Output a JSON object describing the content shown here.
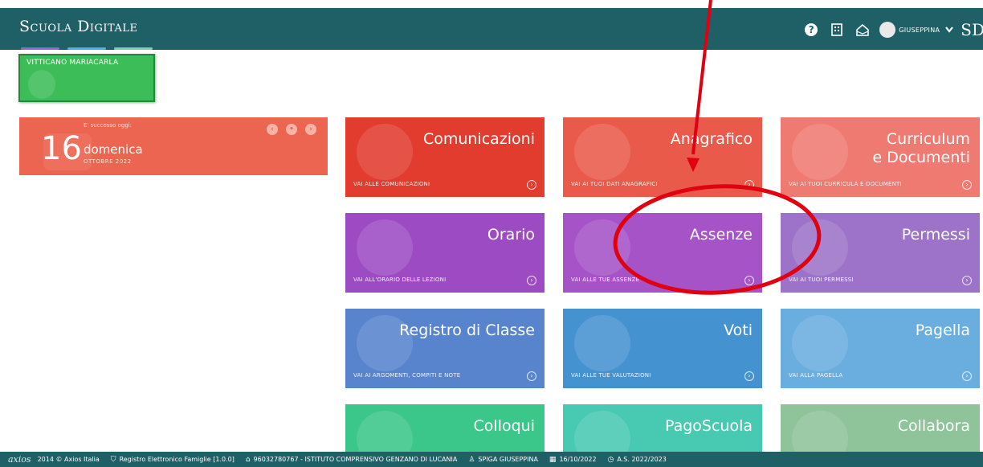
{
  "header": {
    "brand": "Scuola Digitale",
    "user_name": "GIUSEPPINA",
    "logo_short": "SD",
    "colors": {
      "bar": "#1f5f66",
      "line1": "#8e6bd1",
      "line2": "#55aee2",
      "line3": "#7fd0a2"
    }
  },
  "student": {
    "name": "VITTICANO MARIACARLA"
  },
  "calendar": {
    "subtitle": "E' successo oggi:",
    "day": "16",
    "weekday": "domenica",
    "month": "OTTOBRE 2022"
  },
  "tiles": [
    {
      "title": "Comunicazioni",
      "link": "VAI ALLE COMUNICAZIONI",
      "color": "#e23c2f",
      "icon": "megaphone-icon"
    },
    {
      "title": "Anagrafico",
      "link": "VAI AI TUOI DATI ANAGRAFICI",
      "color": "#ea5a4a",
      "icon": "user-icon"
    },
    {
      "title": "Curriculum",
      "title2": "e Documenti",
      "link": "VAI AI TUOI CURRICULA E DOCUMENTI",
      "color": "#ef7a72",
      "icon": "document-icon"
    },
    {
      "title": "Orario",
      "link": "VAI ALL'ORARIO DELLE LEZIONI",
      "color": "#9c4bc3",
      "icon": "clock-icon"
    },
    {
      "title": "Assenze",
      "link": "VAI ALLE TUE ASSENZE",
      "color": "#a553c7",
      "icon": "stethoscope-icon"
    },
    {
      "title": "Permessi",
      "link": "VAI AI TUOI PERMESSI",
      "color": "#9c73c8",
      "icon": "permission-icon"
    },
    {
      "title": "Registro di Classe",
      "link": "VAI AI ARGOMENTI, COMPITI E NOTE",
      "color": "#5784cd",
      "icon": "register-icon"
    },
    {
      "title": "Voti",
      "link": "VAI ALLE TUE VALUTAZIONI",
      "color": "#4592d1",
      "icon": "grades-icon"
    },
    {
      "title": "Pagella",
      "link": "VAI ALLA PAGELLA",
      "color": "#6aaee0",
      "icon": "report-card-icon"
    },
    {
      "title": "Colloqui",
      "link": "",
      "color": "#3bc68a",
      "icon": "chat-icon"
    },
    {
      "title": "PagoScuola",
      "link": "",
      "color": "#48c9b1",
      "icon": "payment-icon"
    },
    {
      "title": "Collabora",
      "link": "",
      "color": "#8fc39a",
      "icon": "collaborate-icon"
    }
  ],
  "annotation": {
    "color": "#e0000f"
  },
  "footer": {
    "logo": "axios",
    "copyright": "2014 © Axios Italia",
    "app": "Registro Elettronico Famiglie [1.0.0]",
    "school": "96032780767 - ISTITUTO COMPRENSIVO GENZANO DI LUCANIA",
    "user": "SPIGA GIUSEPPINA",
    "date": "16/10/2022",
    "year": "A.S. 2022/2023"
  }
}
